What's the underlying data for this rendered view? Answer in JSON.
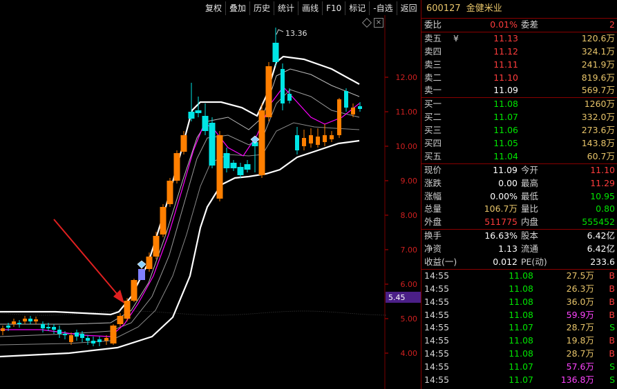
{
  "toolbar": [
    "复权",
    "叠加",
    "历史",
    "统计",
    "画线",
    "F10",
    "标记",
    "-自选",
    "返回"
  ],
  "chart": {
    "peak_label": "13.36",
    "price_tag": "5.45",
    "y_ticks": [
      "12.00",
      "11.00",
      "10.00",
      "9.00",
      "8.00",
      "7.00",
      "6.00",
      "5.00",
      "4.00"
    ],
    "colors": {
      "up": "#ff7f00",
      "down": "#00e5e5",
      "ma": "#ff00ff",
      "band": "#ffffff",
      "arrow": "#e02020",
      "tag_bg": "#4b1f87"
    }
  },
  "stock": {
    "code": "600127",
    "name": "金健米业"
  },
  "ratio": {
    "label": "委比",
    "value": "0.01%",
    "label2": "委差",
    "value2": "2"
  },
  "asks": [
    {
      "label": "卖五",
      "price": "11.13",
      "vol": "120.6万",
      "color": "red",
      "mark": "¥"
    },
    {
      "label": "卖四",
      "price": "11.12",
      "vol": "324.1万",
      "color": "red",
      "mark": ""
    },
    {
      "label": "卖三",
      "price": "11.11",
      "vol": "241.9万",
      "color": "red",
      "mark": ""
    },
    {
      "label": "卖二",
      "price": "11.10",
      "vol": "819.6万",
      "color": "red",
      "mark": ""
    },
    {
      "label": "卖一",
      "price": "11.09",
      "vol": "569.7万",
      "color": "white",
      "mark": ""
    }
  ],
  "bids": [
    {
      "label": "买一",
      "price": "11.08",
      "vol": "1260万",
      "color": "green"
    },
    {
      "label": "买二",
      "price": "11.07",
      "vol": "332.0万",
      "color": "green"
    },
    {
      "label": "买三",
      "price": "11.06",
      "vol": "273.6万",
      "color": "green"
    },
    {
      "label": "买四",
      "price": "11.05",
      "vol": "143.8万",
      "color": "green"
    },
    {
      "label": "买五",
      "price": "11.04",
      "vol": "60.7万",
      "color": "green"
    }
  ],
  "quote1": [
    {
      "l1": "现价",
      "v1": "11.09",
      "c1": "white",
      "l2": "今开",
      "v2": "11.10",
      "c2": "red"
    },
    {
      "l1": "涨跌",
      "v1": "0.00",
      "c1": "white",
      "l2": "最高",
      "v2": "11.29",
      "c2": "red"
    },
    {
      "l1": "涨幅",
      "v1": "0.00%",
      "c1": "white",
      "l2": "最低",
      "v2": "10.95",
      "c2": "green"
    },
    {
      "l1": "总量",
      "v1": "106.7万",
      "c1": "yellow",
      "l2": "量比",
      "v2": "0.80",
      "c2": "green"
    },
    {
      "l1": "外盘",
      "v1": "511775",
      "c1": "red",
      "l2": "内盘",
      "v2": "555452",
      "c2": "green"
    }
  ],
  "quote2": [
    {
      "l1": "换手",
      "v1": "16.63%",
      "c1": "white",
      "l2": "股本",
      "v2": "6.42亿",
      "c2": "white"
    },
    {
      "l1": "净资",
      "v1": "1.13",
      "c1": "white",
      "l2": "流通",
      "v2": "6.42亿",
      "c2": "white"
    },
    {
      "l1": "收益(一)",
      "v1": "0.012",
      "c1": "white",
      "l2": "PE(动)",
      "v2": "233.6",
      "c2": "white"
    }
  ],
  "ticks": [
    {
      "time": "14:55",
      "price": "11.08",
      "vol": "27.5万",
      "side": "B",
      "vc": "yellow",
      "sc": "red"
    },
    {
      "time": "14:55",
      "price": "11.08",
      "vol": "26.3万",
      "side": "B",
      "vc": "yellow",
      "sc": "red"
    },
    {
      "time": "14:55",
      "price": "11.08",
      "vol": "36.0万",
      "side": "B",
      "vc": "yellow",
      "sc": "red"
    },
    {
      "time": "14:55",
      "price": "11.08",
      "vol": "59.9万",
      "side": "B",
      "vc": "magenta",
      "sc": "red"
    },
    {
      "time": "14:55",
      "price": "11.07",
      "vol": "28.7万",
      "side": "S",
      "vc": "yellow",
      "sc": "green"
    },
    {
      "time": "14:55",
      "price": "11.08",
      "vol": "19.8万",
      "side": "B",
      "vc": "yellow",
      "sc": "red"
    },
    {
      "time": "14:55",
      "price": "11.08",
      "vol": "28.7万",
      "side": "B",
      "vc": "yellow",
      "sc": "red"
    },
    {
      "time": "14:55",
      "price": "11.07",
      "vol": "57.6万",
      "side": "S",
      "vc": "magenta",
      "sc": "green"
    },
    {
      "time": "14:55",
      "price": "11.07",
      "vol": "136.8万",
      "side": "S",
      "vc": "magenta",
      "sc": "green"
    }
  ]
}
